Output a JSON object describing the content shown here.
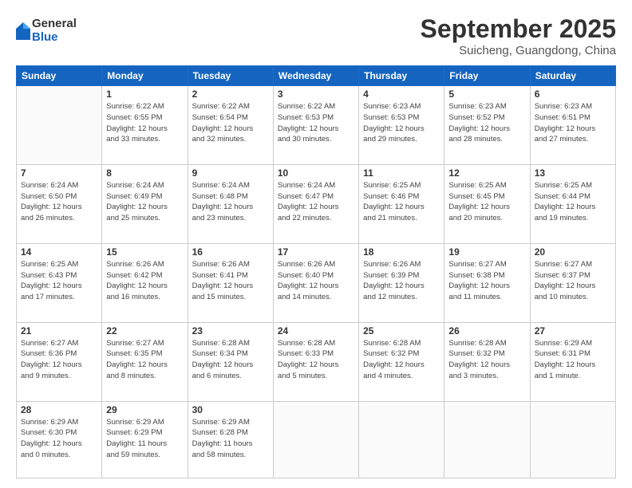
{
  "header": {
    "logo_general": "General",
    "logo_blue": "Blue",
    "month": "September 2025",
    "location": "Suicheng, Guangdong, China"
  },
  "weekdays": [
    "Sunday",
    "Monday",
    "Tuesday",
    "Wednesday",
    "Thursday",
    "Friday",
    "Saturday"
  ],
  "weeks": [
    [
      {
        "day": "",
        "info": ""
      },
      {
        "day": "1",
        "info": "Sunrise: 6:22 AM\nSunset: 6:55 PM\nDaylight: 12 hours\nand 33 minutes."
      },
      {
        "day": "2",
        "info": "Sunrise: 6:22 AM\nSunset: 6:54 PM\nDaylight: 12 hours\nand 32 minutes."
      },
      {
        "day": "3",
        "info": "Sunrise: 6:22 AM\nSunset: 6:53 PM\nDaylight: 12 hours\nand 30 minutes."
      },
      {
        "day": "4",
        "info": "Sunrise: 6:23 AM\nSunset: 6:53 PM\nDaylight: 12 hours\nand 29 minutes."
      },
      {
        "day": "5",
        "info": "Sunrise: 6:23 AM\nSunset: 6:52 PM\nDaylight: 12 hours\nand 28 minutes."
      },
      {
        "day": "6",
        "info": "Sunrise: 6:23 AM\nSunset: 6:51 PM\nDaylight: 12 hours\nand 27 minutes."
      }
    ],
    [
      {
        "day": "7",
        "info": "Sunrise: 6:24 AM\nSunset: 6:50 PM\nDaylight: 12 hours\nand 26 minutes."
      },
      {
        "day": "8",
        "info": "Sunrise: 6:24 AM\nSunset: 6:49 PM\nDaylight: 12 hours\nand 25 minutes."
      },
      {
        "day": "9",
        "info": "Sunrise: 6:24 AM\nSunset: 6:48 PM\nDaylight: 12 hours\nand 23 minutes."
      },
      {
        "day": "10",
        "info": "Sunrise: 6:24 AM\nSunset: 6:47 PM\nDaylight: 12 hours\nand 22 minutes."
      },
      {
        "day": "11",
        "info": "Sunrise: 6:25 AM\nSunset: 6:46 PM\nDaylight: 12 hours\nand 21 minutes."
      },
      {
        "day": "12",
        "info": "Sunrise: 6:25 AM\nSunset: 6:45 PM\nDaylight: 12 hours\nand 20 minutes."
      },
      {
        "day": "13",
        "info": "Sunrise: 6:25 AM\nSunset: 6:44 PM\nDaylight: 12 hours\nand 19 minutes."
      }
    ],
    [
      {
        "day": "14",
        "info": "Sunrise: 6:25 AM\nSunset: 6:43 PM\nDaylight: 12 hours\nand 17 minutes."
      },
      {
        "day": "15",
        "info": "Sunrise: 6:26 AM\nSunset: 6:42 PM\nDaylight: 12 hours\nand 16 minutes."
      },
      {
        "day": "16",
        "info": "Sunrise: 6:26 AM\nSunset: 6:41 PM\nDaylight: 12 hours\nand 15 minutes."
      },
      {
        "day": "17",
        "info": "Sunrise: 6:26 AM\nSunset: 6:40 PM\nDaylight: 12 hours\nand 14 minutes."
      },
      {
        "day": "18",
        "info": "Sunrise: 6:26 AM\nSunset: 6:39 PM\nDaylight: 12 hours\nand 12 minutes."
      },
      {
        "day": "19",
        "info": "Sunrise: 6:27 AM\nSunset: 6:38 PM\nDaylight: 12 hours\nand 11 minutes."
      },
      {
        "day": "20",
        "info": "Sunrise: 6:27 AM\nSunset: 6:37 PM\nDaylight: 12 hours\nand 10 minutes."
      }
    ],
    [
      {
        "day": "21",
        "info": "Sunrise: 6:27 AM\nSunset: 6:36 PM\nDaylight: 12 hours\nand 9 minutes."
      },
      {
        "day": "22",
        "info": "Sunrise: 6:27 AM\nSunset: 6:35 PM\nDaylight: 12 hours\nand 8 minutes."
      },
      {
        "day": "23",
        "info": "Sunrise: 6:28 AM\nSunset: 6:34 PM\nDaylight: 12 hours\nand 6 minutes."
      },
      {
        "day": "24",
        "info": "Sunrise: 6:28 AM\nSunset: 6:33 PM\nDaylight: 12 hours\nand 5 minutes."
      },
      {
        "day": "25",
        "info": "Sunrise: 6:28 AM\nSunset: 6:32 PM\nDaylight: 12 hours\nand 4 minutes."
      },
      {
        "day": "26",
        "info": "Sunrise: 6:28 AM\nSunset: 6:32 PM\nDaylight: 12 hours\nand 3 minutes."
      },
      {
        "day": "27",
        "info": "Sunrise: 6:29 AM\nSunset: 6:31 PM\nDaylight: 12 hours\nand 1 minute."
      }
    ],
    [
      {
        "day": "28",
        "info": "Sunrise: 6:29 AM\nSunset: 6:30 PM\nDaylight: 12 hours\nand 0 minutes."
      },
      {
        "day": "29",
        "info": "Sunrise: 6:29 AM\nSunset: 6:29 PM\nDaylight: 11 hours\nand 59 minutes."
      },
      {
        "day": "30",
        "info": "Sunrise: 6:29 AM\nSunset: 6:28 PM\nDaylight: 11 hours\nand 58 minutes."
      },
      {
        "day": "",
        "info": ""
      },
      {
        "day": "",
        "info": ""
      },
      {
        "day": "",
        "info": ""
      },
      {
        "day": "",
        "info": ""
      }
    ]
  ]
}
